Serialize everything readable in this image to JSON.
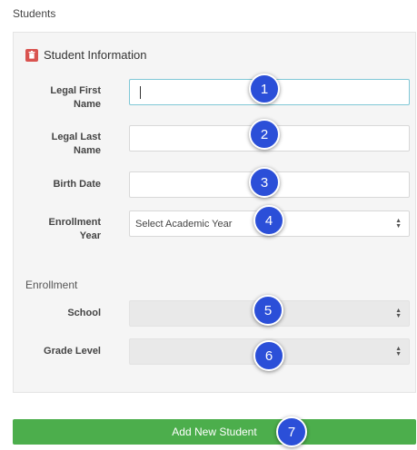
{
  "page": {
    "title": "Students"
  },
  "section": {
    "title": "Student Information"
  },
  "fields": {
    "first_name": {
      "label_line1": "Legal First",
      "label_line2": "Name",
      "value": ""
    },
    "last_name": {
      "label_line1": "Legal Last",
      "label_line2": "Name",
      "value": ""
    },
    "birth_date": {
      "label": "Birth Date",
      "value": ""
    },
    "enrollment_year": {
      "label_line1": "Enrollment",
      "label_line2": "Year",
      "selected": "Select Academic Year"
    }
  },
  "enrollment": {
    "group_label": "Enrollment",
    "school": {
      "label": "School",
      "selected": ""
    },
    "grade_level": {
      "label": "Grade Level",
      "selected": ""
    }
  },
  "badges": [
    "1",
    "2",
    "3",
    "4",
    "5",
    "6",
    "7"
  ],
  "actions": {
    "submit_label": "Add New Student"
  },
  "colors": {
    "badge": "#2b4fd8",
    "submit": "#4cae4c",
    "section_icon": "#d9534f",
    "focus_border": "#7fc7d6"
  }
}
